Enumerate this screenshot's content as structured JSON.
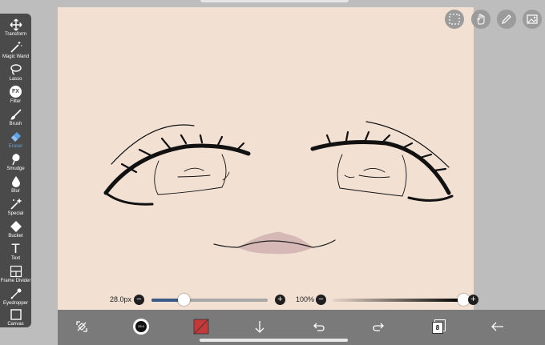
{
  "toolbar": {
    "tools": [
      {
        "label": "Transform",
        "icon": "move-arrows-icon"
      },
      {
        "label": "Magic Wand",
        "icon": "magic-wand-icon"
      },
      {
        "label": "Lasso",
        "icon": "lasso-icon"
      },
      {
        "label": "Filter",
        "icon": "fx-icon"
      },
      {
        "label": "Brush",
        "icon": "brush-icon"
      },
      {
        "label": "Eraser",
        "icon": "eraser-icon"
      },
      {
        "label": "Smudge",
        "icon": "smudge-icon"
      },
      {
        "label": "Blur",
        "icon": "blur-drop-icon"
      },
      {
        "label": "Special",
        "icon": "special-wand-icon"
      },
      {
        "label": "Bucket",
        "icon": "bucket-icon"
      },
      {
        "label": "Text",
        "icon": "text-t-icon"
      },
      {
        "label": "Frame Divider",
        "icon": "frame-divider-icon"
      },
      {
        "label": "Eyedropper",
        "icon": "eyedropper-icon"
      },
      {
        "label": "Canvas",
        "icon": "canvas-icon"
      }
    ],
    "active": "Eraser",
    "filter_glyph": "FX",
    "text_glyph": "T"
  },
  "brush_size": {
    "value_label": "28.0px",
    "fraction": 0.28,
    "minus": "−",
    "plus": "+"
  },
  "opacity": {
    "value_label": "100%",
    "fraction": 1.0,
    "minus": "−",
    "plus": "+"
  },
  "bottom_bar": {
    "layers_count": "8",
    "brush_preview_label": "28.0"
  },
  "colors": {
    "canvas": "#f2e1d3",
    "toolbar": "#4a4a4a",
    "active_tool": "#5ea2e6",
    "primary_color": "#c43a3a",
    "slider_fill": "#3a5a8a"
  }
}
